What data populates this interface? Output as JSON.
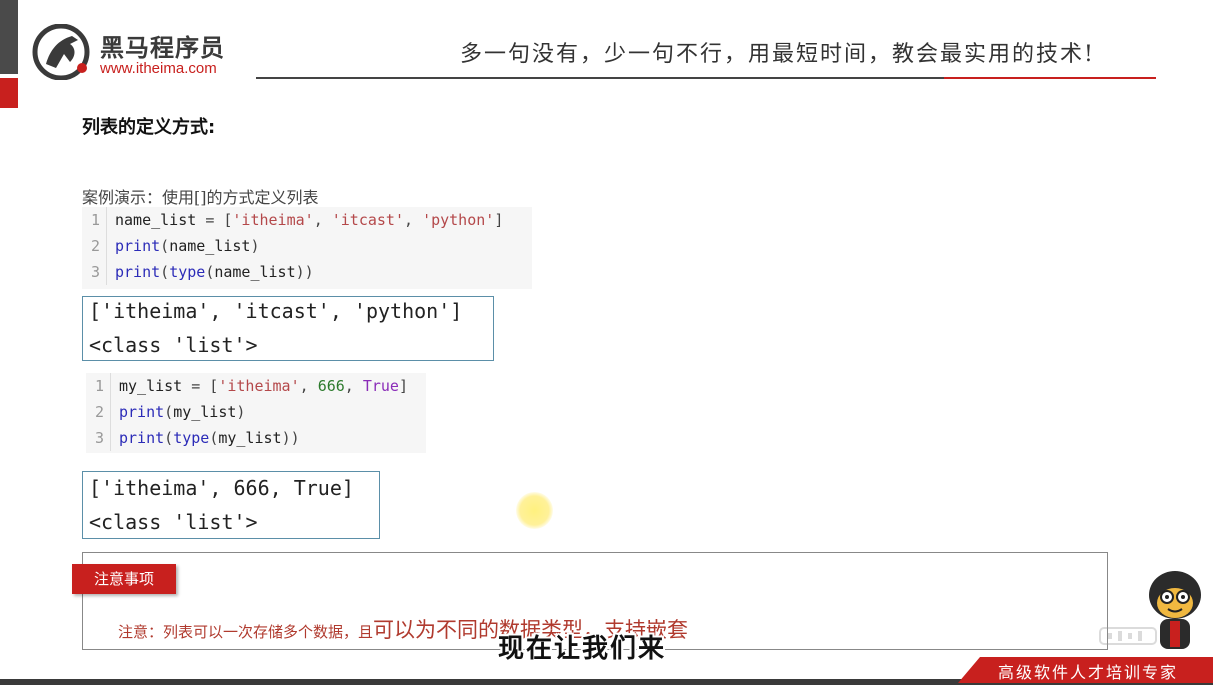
{
  "header": {
    "logo_name": "黑马程序员",
    "logo_url": "www.itheima.com",
    "slogan": "多一句没有，少一句不行，用最短时间，教会最实用的技术!"
  },
  "section_title": "列表的定义方式:",
  "demo_label": "案例演示：使用[]的方式定义列表",
  "code1": [
    {
      "num": "1",
      "tokens": [
        [
          "id",
          "name_list "
        ],
        [
          "op",
          "= ["
        ],
        [
          "str",
          "'itheima'"
        ],
        [
          "op",
          ", "
        ],
        [
          "str",
          "'itcast'"
        ],
        [
          "op",
          ", "
        ],
        [
          "str",
          "'python'"
        ],
        [
          "op",
          "]"
        ]
      ]
    },
    {
      "num": "2",
      "tokens": [
        [
          "fn",
          "print"
        ],
        [
          "op",
          "("
        ],
        [
          "id",
          "name_list"
        ],
        [
          "op",
          ")"
        ]
      ]
    },
    {
      "num": "3",
      "tokens": [
        [
          "fn",
          "print"
        ],
        [
          "op",
          "("
        ],
        [
          "fn",
          "type"
        ],
        [
          "op",
          "("
        ],
        [
          "id",
          "name_list"
        ],
        [
          "op",
          "))"
        ]
      ]
    }
  ],
  "output1": [
    "['itheima', 'itcast', 'python']",
    "<class 'list'>"
  ],
  "code2": [
    {
      "num": "1",
      "tokens": [
        [
          "id",
          "my_list "
        ],
        [
          "op",
          "= ["
        ],
        [
          "str",
          "'itheima'"
        ],
        [
          "op",
          ", "
        ],
        [
          "num",
          "666"
        ],
        [
          "op",
          ", "
        ],
        [
          "kw",
          "True"
        ],
        [
          "op",
          "]"
        ]
      ]
    },
    {
      "num": "2",
      "tokens": [
        [
          "fn",
          "print"
        ],
        [
          "op",
          "("
        ],
        [
          "id",
          "my_list"
        ],
        [
          "op",
          ")"
        ]
      ]
    },
    {
      "num": "3",
      "tokens": [
        [
          "fn",
          "print"
        ],
        [
          "op",
          "("
        ],
        [
          "fn",
          "type"
        ],
        [
          "op",
          "("
        ],
        [
          "id",
          "my_list"
        ],
        [
          "op",
          "))"
        ]
      ]
    }
  ],
  "output2": [
    "['itheima', 666, True]",
    "<class 'list'>"
  ],
  "note": {
    "badge": "注意事项",
    "text_small": "注意：列表可以一次存储多个数据，且",
    "text_big": "可以为不同的数据类型，支持嵌套"
  },
  "subtitle": "现在让我们来",
  "footer_text": "高级软件人才培训专家",
  "colors": {
    "brand_red": "#c8201e",
    "dark": "#3a3a3a",
    "output_border": "#5b8fa8"
  }
}
